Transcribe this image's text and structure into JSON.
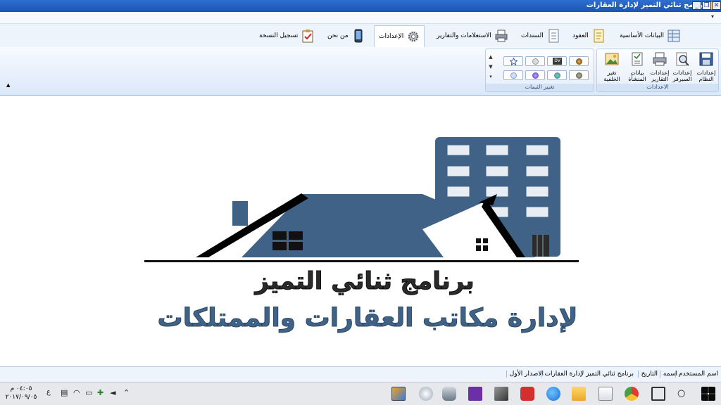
{
  "window": {
    "title": "برنامج ثنائي التميز لإدارة العقارات",
    "minimize_glyph": "_",
    "restore_glyph": "❐",
    "close_glyph": "✕"
  },
  "tabs": [
    {
      "label": "البيانات الأساسية",
      "icon": "table-icon"
    },
    {
      "label": "العقود",
      "icon": "document-icon"
    },
    {
      "label": "السندات",
      "icon": "receipt-icon"
    },
    {
      "label": "الاستعلامات والتقارير",
      "icon": "printer-icon"
    },
    {
      "label": "الإعدادات",
      "icon": "gear-icon"
    },
    {
      "label": "من نحن",
      "icon": "phone-icon"
    },
    {
      "label": "تسجيل النسخة",
      "icon": "clipboard-check-icon"
    }
  ],
  "ribbon": {
    "settings_group": {
      "label": "الاعدادات",
      "buttons": [
        {
          "label": "إعدادات النظام",
          "icon": "floppy-disk-icon"
        },
        {
          "label": "إعدادات السيرفر",
          "icon": "magnifier-settings-icon"
        },
        {
          "label": "إعدادات التقارير",
          "icon": "printer-icon"
        },
        {
          "label": "بيانات المنشأة",
          "icon": "building-data-icon"
        },
        {
          "label": "تغير الخلفية",
          "icon": "image-icon"
        }
      ]
    },
    "themes_group": {
      "label": "تغيير الثيمات",
      "themes": [
        "theme-1",
        "theme-2",
        "theme-3",
        "theme-4",
        "theme-5",
        "theme-6",
        "theme-7",
        "theme-8"
      ],
      "theme_badge": "DV"
    }
  },
  "logo": {
    "line1": "برنامج ثنائي التميز",
    "line2": "لإدارة مكاتب العقارات والممتلكات",
    "building_color": "#3f6286",
    "roof_color": "#000000"
  },
  "statusbar": {
    "username_label": "اسم المستخدم",
    "username_value": "اسمه",
    "date_label": "التاريخ",
    "program_name": "برنامج ثنائي التميز لإدارة العقارات",
    "version": "الاصدار الأول"
  },
  "taskbar": {
    "time": "٠٤:٠٥ م",
    "date": "٢٠١٧/٠٩/٠٥",
    "lang": "ع"
  },
  "colors": {
    "titlebar": "#2f6fcf",
    "ribbon": "#dbe8f8",
    "accent": "#3f6286"
  }
}
